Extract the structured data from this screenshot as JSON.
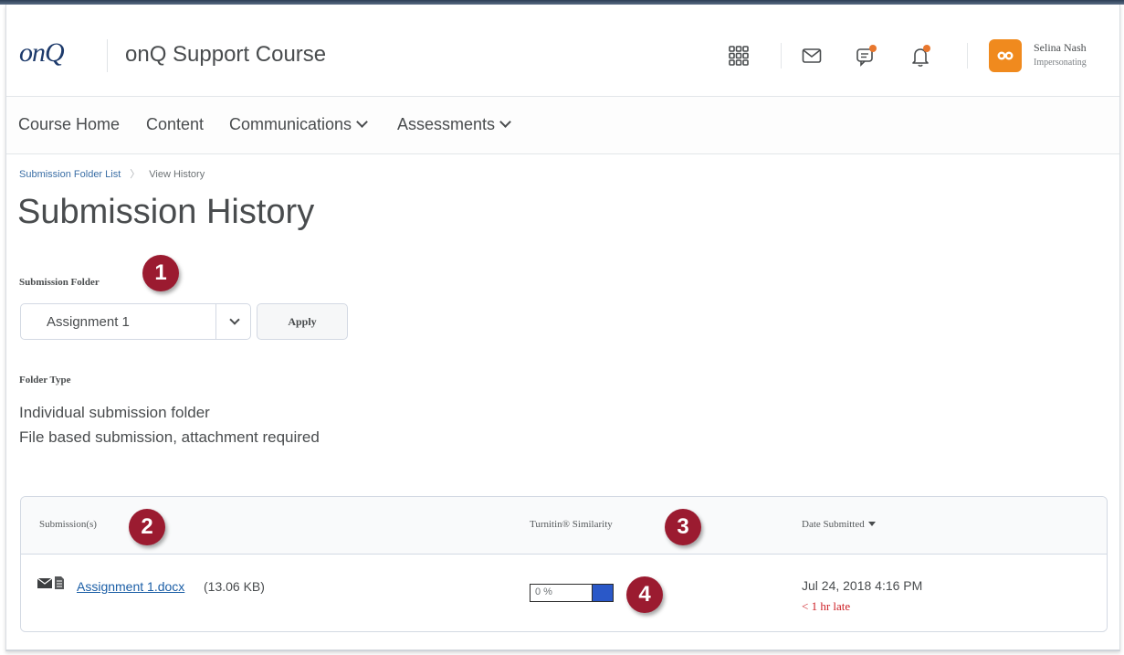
{
  "header": {
    "logo_text": "onQ",
    "course_title": "onQ Support Course",
    "user_name": "Selina Nash",
    "user_role": "Impersonating",
    "icons": [
      "waffle-icon",
      "mail-icon",
      "chat-icon",
      "bell-icon"
    ],
    "accent_color": "#f08a1e",
    "badge_color": "#e8772e"
  },
  "nav": {
    "items": [
      {
        "label": "Course Home",
        "dropdown": false
      },
      {
        "label": "Content",
        "dropdown": false
      },
      {
        "label": "Communications",
        "dropdown": true
      },
      {
        "label": "Assessments",
        "dropdown": true
      }
    ]
  },
  "breadcrumb": {
    "link": "Submission Folder List",
    "current": "View History"
  },
  "page": {
    "title": "Submission History",
    "folder_label": "Submission Folder",
    "folder_selected": "Assignment 1",
    "apply_label": "Apply",
    "folder_type_label": "Folder Type",
    "folder_type_lines": [
      "Individual submission folder",
      "File based submission, attachment required"
    ]
  },
  "table": {
    "columns": [
      "Submission(s)",
      "Turnitin® Similarity",
      "Date Submitted"
    ],
    "rows": [
      {
        "file_name": "Assignment 1.docx",
        "file_size": "(13.06 KB)",
        "similarity": "0 %",
        "date": "Jul 24, 2018 4:16 PM",
        "late": "< 1 hr late"
      }
    ]
  },
  "callouts": [
    "1",
    "2",
    "3",
    "4"
  ],
  "colors": {
    "callout": "#9b1b30",
    "link": "#1b5ea6",
    "late": "#cd2026",
    "similarity_fill": "#2a58c8"
  }
}
